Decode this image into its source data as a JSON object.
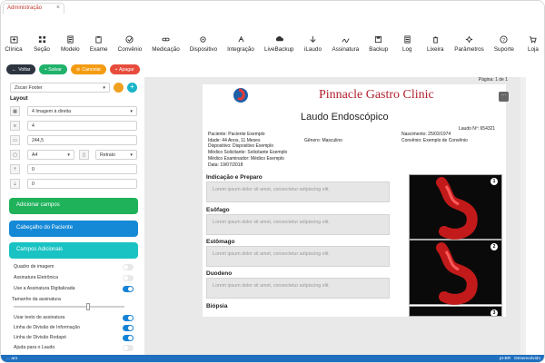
{
  "window": {
    "tab_title": "Administração"
  },
  "toolbar": [
    {
      "label": "Clínica",
      "icon": "clinic-icon"
    },
    {
      "label": "Seção",
      "icon": "section-icon"
    },
    {
      "label": "Modelo",
      "icon": "model-icon"
    },
    {
      "label": "Exame",
      "icon": "exam-icon"
    },
    {
      "label": "Convênio",
      "icon": "agreement-icon"
    },
    {
      "label": "Medicação",
      "icon": "medication-icon"
    },
    {
      "label": "Dispositivo",
      "icon": "device-icon"
    },
    {
      "label": "Integração",
      "icon": "integration-icon"
    },
    {
      "label": "LiveBackup",
      "icon": "live-backup-icon"
    },
    {
      "label": "iLaudo",
      "icon": "ilaudo-icon"
    },
    {
      "label": "Assinatura",
      "icon": "signature-icon"
    },
    {
      "label": "Backup",
      "icon": "backup-icon"
    },
    {
      "label": "Log",
      "icon": "log-icon"
    },
    {
      "label": "Lixeira",
      "icon": "trash-icon"
    },
    {
      "label": "Parâmetros",
      "icon": "parameters-icon"
    },
    {
      "label": "Suporte",
      "icon": "support-icon"
    },
    {
      "label": "Loja",
      "icon": "store-icon"
    }
  ],
  "actions": {
    "back": "Voltar",
    "save": "Salvar",
    "cancel": "Cancelar",
    "delete": "Apagar"
  },
  "sidebar": {
    "model_select": "Zscan Footer",
    "layout_label": "Layout",
    "images_per_row": "4 Imagem à direita",
    "field_count": "4",
    "field_size": "244,5",
    "paper_size": "A4",
    "orientation": "Retrato",
    "margin_top": "0",
    "margin_bottom": "0",
    "add_fields": "Adicionar campos",
    "patient_header": "Cabeçalho do Paciente",
    "extra_fields": "Campos Adicionais",
    "options": [
      {
        "label": "Quadro de imagem",
        "on": false
      },
      {
        "label": "Assinatura Eletrônica",
        "on": false
      },
      {
        "label": "Use a Assinatura Digitalizada",
        "on": true
      }
    ],
    "signature_size": "Tamanho da assinatura",
    "options2": [
      {
        "label": "Usar texto de assinatura",
        "on": true
      },
      {
        "label": "Linha de Divisão de Informação",
        "on": true
      },
      {
        "label": "Linha de Divisão Rodapé",
        "on": true
      },
      {
        "label": "Ajuda para o Laudo",
        "on": false
      }
    ]
  },
  "report": {
    "page_indicator": "Página: 1 de 1",
    "clinic_name": "Pinnacle Gastro Clinic",
    "title": "Laudo Endoscópico",
    "laudo_no": "Laudo Nº: 654321",
    "patient": "Paciente: Paciente Exemplo",
    "age": "Idade: 44 Anos, 11 Meses",
    "gender": "Gênero: Masculino",
    "birth": "Nascimento: 25/03/1974",
    "agreement": "Convênio: Exemplo de Convênio",
    "device": "Dispositivo: Dispositivo Exemplo",
    "requester": "Médico Solicitante: Solicitante Exemplo",
    "examiner": "Médico Examinador: Médico Exemplo",
    "date": "Data: 19/07/2018",
    "sections": [
      {
        "title": "Indicação e Preparo",
        "text": "Lorem ipsum dolor sit amet, consectetur adipiscing elit."
      },
      {
        "title": "Esôfago",
        "text": "Lorem ipsum dolor sit amet, consectetur adipiscing elit."
      },
      {
        "title": "Estômago",
        "text": "Lorem ipsum dolor sit amet, consectetur adipiscing elit."
      },
      {
        "title": "Duodeno",
        "text": "Lorem ipsum dolor sit amet, consectetur adipiscing elit."
      },
      {
        "title": "Biópsia",
        "text": ""
      }
    ],
    "images": [
      "1",
      "2",
      "3"
    ]
  },
  "status": {
    "left": "... aro",
    "right_lang": "pt-BR",
    "right_dev": "Desenvolvido"
  },
  "colors": {
    "accent_red": "#b21f2d",
    "status_blue": "#1f6fbf",
    "green": "#1fb25a",
    "blue": "#1589d6",
    "teal": "#19c3c3"
  }
}
